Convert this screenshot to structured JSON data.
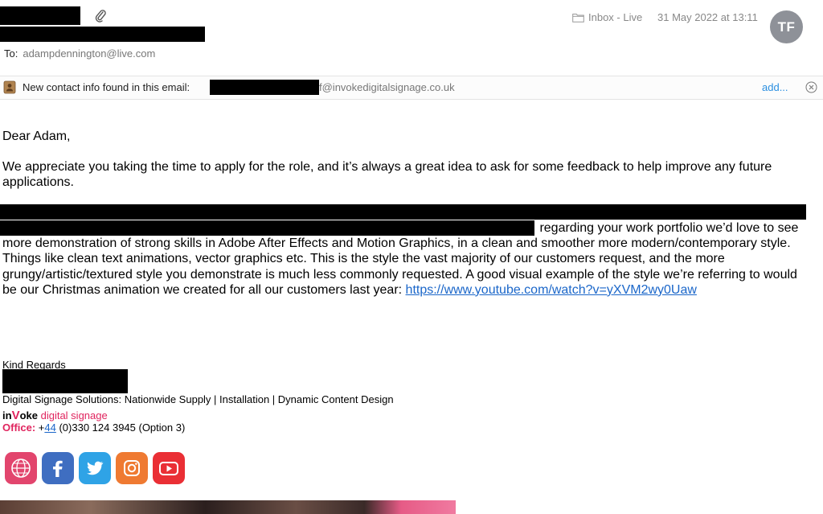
{
  "header": {
    "mailbox": "Inbox - Live",
    "date": "31 May 2022 at 13:11",
    "avatar_initials": "TF",
    "to_label": "To:",
    "to_address": "adampdennington@live.com",
    "attachment_icon": "paperclip-icon"
  },
  "contact_banner": {
    "text": "New contact info found in this email:",
    "email_suffix": "f@invokedigitalsignage.co.uk",
    "add_label": "add...",
    "icon": "contact-card-icon"
  },
  "message": {
    "greeting": "Dear Adam,",
    "paragraph1": "We appreciate you taking the time to apply for the role, and it’s always a great idea to ask for some feedback to help improve any future applications.",
    "paragraph2_visible": " regarding your work portfolio we’d love to see more demonstration of strong skills in Adobe After Effects and Motion Graphics, in a clean and smoother more modern/contemporary style. Things like clean text animations, vector graphics etc. This is the style the vast majority of our customers request, and the more grungy/artistic/textured style you demonstrate is much less commonly requested. A good visual example of the style we’re referring to would be our Christmas animation we created for all our customers last year: ",
    "link": "https://www.youtube.com/watch?v=yXVM2wy0Uaw"
  },
  "signature": {
    "closing": "Kind Regards",
    "tagline": "Digital Signage Solutions: Nationwide Supply | Installation | Dynamic Content Design",
    "brand_in": "in",
    "brand_v": "V",
    "brand_oke": "oke",
    "brand_rest": " digital signage",
    "office_label": "Office:",
    "office_prefix": " +",
    "office_code": "44",
    "office_number": " (0)330 124 3945 (Option 3)",
    "social_icons": [
      "website-icon",
      "facebook-icon",
      "twitter-icon",
      "instagram-icon",
      "youtube-icon"
    ]
  },
  "colors": {
    "brand_pink": "#e0245e",
    "link_blue": "#1a66c9",
    "add_blue": "#2b8fe0",
    "avatar_gray": "#8e9198"
  }
}
